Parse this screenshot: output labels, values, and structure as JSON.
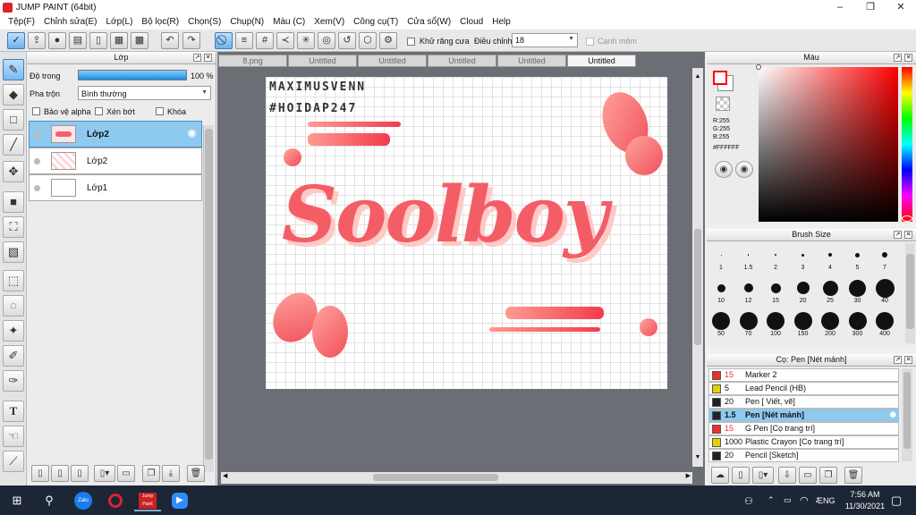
{
  "window": {
    "title": "JUMP PAINT (64bit)",
    "minimize": "–",
    "maximize": "❐",
    "close": "✕"
  },
  "menu": [
    "Tệp(F)",
    "Chỉnh sửa(E)",
    "Lớp(L)",
    "Bộ lọc(R)",
    "Chọn(S)",
    "Chụp(N)",
    "Màu (C)",
    "Xem(V)",
    "Công cụ(T)",
    "Cửa sổ(W)",
    "Cloud",
    "Help"
  ],
  "toolbar": {
    "antialias_label": "Khử răng cưa",
    "adjust_label": "Điều chỉnh",
    "adjust_value": "18",
    "edge_label": "Cạnh mềm"
  },
  "layer_panel": {
    "title": "Lớp",
    "opacity_label": "Độ trong",
    "opacity_value": "100 %",
    "opacity": 1.0,
    "blend_label": "Pha trộn",
    "blend_value": "Bình thường",
    "protect_alpha": "Bảo vệ alpha",
    "clip": "Xén bớt",
    "lock": "Khóa",
    "layers": [
      {
        "name": "Lớp2",
        "selected": true
      },
      {
        "name": "Lớp2",
        "selected": false
      },
      {
        "name": "Lớp1",
        "selected": false
      }
    ]
  },
  "tabs": [
    "8.png",
    "Untitled",
    "Untitled",
    "Untitled",
    "Untitled",
    "Untitled"
  ],
  "canvas": {
    "text_line1": "MAXIMUSVENN",
    "text_line2": "#HOIDAP247",
    "lettering": "Soolboy",
    "accent": "#f0505a"
  },
  "color_panel": {
    "title": "Màu",
    "r": "R:255",
    "g": "G:255",
    "b": "B:255",
    "hex": "#FFFFFF",
    "primary_color": "#ff0000"
  },
  "brush_size_panel": {
    "title": "Brush Size",
    "sizes": [
      "1",
      "1.5",
      "2",
      "3",
      "4",
      "5",
      "7",
      "10",
      "12",
      "15",
      "20",
      "25",
      "30",
      "40",
      "50",
      "70",
      "100",
      "150",
      "200",
      "300",
      "400"
    ]
  },
  "brush_panel": {
    "title": "Cọ: Pen [Nét mảnh]",
    "brushes": [
      {
        "size": "15",
        "name": "Marker 2",
        "color": "#e83030",
        "selected": false
      },
      {
        "size": "5",
        "name": "Lead Pencil (HB)",
        "color": "#e8d000",
        "selected": false
      },
      {
        "size": "20",
        "name": "Pen [ Viết, vẽ]",
        "color": "#222222",
        "selected": false
      },
      {
        "size": "1.5",
        "name": "Pen [Nét mảnh]",
        "color": "#222222",
        "selected": true
      },
      {
        "size": "15",
        "name": "G Pen [Cọ trang trí]",
        "color": "#e83030",
        "selected": false
      },
      {
        "size": "1000",
        "name": "Plastic Crayon [Cọ trang trí]",
        "color": "#e8d000",
        "selected": false
      },
      {
        "size": "20",
        "name": "Pencil [Sketch]",
        "color": "#222222",
        "selected": false
      }
    ]
  },
  "taskbar": {
    "apps": [
      "Zalo",
      "Opera",
      "Jump Paint",
      "Zoom"
    ],
    "lang": "ENG",
    "time": "7:56 AM",
    "date": "11/30/2021"
  }
}
